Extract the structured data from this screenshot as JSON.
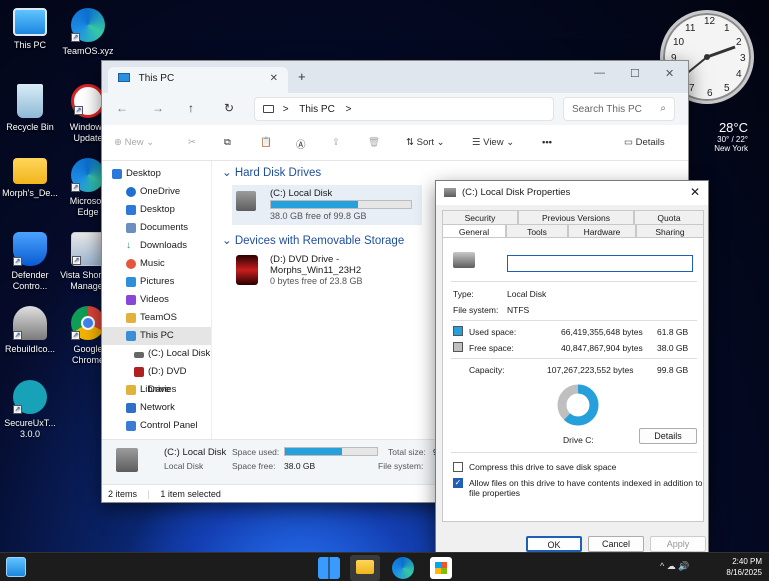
{
  "desktop": {
    "icons": [
      {
        "label": "This PC"
      },
      {
        "label": "TeamOS.xyz"
      },
      {
        "label": "Recycle Bin"
      },
      {
        "label": "Windows Update"
      },
      {
        "label": "Morph's_De..."
      },
      {
        "label": "Microsoft Edge"
      },
      {
        "label": "Defender Contro..."
      },
      {
        "label": "Vista Shortcut Manager"
      },
      {
        "label": "RebuildIco..."
      },
      {
        "label": "Google Chrome"
      },
      {
        "label": "SecureUxT... 3.0.0"
      }
    ],
    "clock_numbers": [
      "12",
      "1",
      "2",
      "3",
      "4",
      "5",
      "6",
      "7",
      "8",
      "9",
      "10",
      "11"
    ],
    "weather": {
      "temp": "28°C",
      "range": "30° / 22°",
      "city": "New York"
    }
  },
  "explorer": {
    "tab_title": "This PC",
    "tab_close": "✕",
    "new_tab": "+",
    "window_controls": {
      "minimize": "—",
      "maximize": "☐",
      "close": "✕"
    },
    "address": {
      "root_sep": ">",
      "location": "This PC",
      "trailing_sep": ">"
    },
    "search_placeholder": "Search This PC",
    "commands": {
      "new": "New",
      "sort": "Sort",
      "view": "View",
      "more": "•••",
      "details": "Details"
    },
    "nav": [
      {
        "label": "Desktop",
        "color": "#2b79d8"
      },
      {
        "label": "OneDrive",
        "color": "#1f6fd1"
      },
      {
        "label": "Desktop",
        "color": "#2b79d8"
      },
      {
        "label": "Documents",
        "color": "#6b8fbf"
      },
      {
        "label": "Downloads",
        "color": "#1c9b63"
      },
      {
        "label": "Music",
        "color": "#e4573d"
      },
      {
        "label": "Pictures",
        "color": "#2d8ed9"
      },
      {
        "label": "Videos",
        "color": "#8a46d6"
      },
      {
        "label": "TeamOS",
        "color": "#e2b33a"
      },
      {
        "label": "This PC",
        "color": "#3a8ed6"
      },
      {
        "label": "(C:) Local Disk",
        "color": "#666"
      },
      {
        "label": "(D:) DVD Drive",
        "color": "#b02020"
      },
      {
        "label": "Libraries",
        "color": "#e2b33a"
      },
      {
        "label": "Network",
        "color": "#2d6fc9"
      },
      {
        "label": "Control Panel",
        "color": "#3a7bd5"
      }
    ],
    "groups": {
      "hard_disk": "Hard Disk Drives",
      "removable": "Devices with Removable Storage"
    },
    "drives": {
      "c": {
        "name": "(C:) Local Disk",
        "free": "38.0 GB free of 99.8 GB",
        "used_fraction": 0.619
      },
      "d": {
        "name_line1": "(D:) DVD Drive -",
        "name_line2": "Morphs_Win11_23H2",
        "free": "0 bytes free of 23.8 GB"
      }
    },
    "details_pane": {
      "name": "(C:) Local Disk",
      "type": "Local Disk",
      "space_used_label": "Space used:",
      "space_free_label": "Space free:",
      "space_free": "38.0 GB",
      "total_size_label": "Total size:",
      "total_size": "9",
      "file_system_label": "File system:",
      "used_fraction": 0.619
    },
    "status": {
      "items": "2 items",
      "selected": "1 item selected"
    }
  },
  "properties": {
    "title": "(C:) Local Disk Properties",
    "tabs_top": [
      "Security",
      "Previous Versions",
      "Quota"
    ],
    "tabs_bottom": [
      "General",
      "Tools",
      "Hardware",
      "Sharing"
    ],
    "label_value": "",
    "type_label": "Type:",
    "type_value": "Local Disk",
    "fs_label": "File system:",
    "fs_value": "NTFS",
    "used_label": "Used space:",
    "used_bytes": "66,419,355,648 bytes",
    "used_gb": "61.8 GB",
    "free_label": "Free space:",
    "free_bytes": "40,847,867,904 bytes",
    "free_gb": "38.0 GB",
    "capacity_label": "Capacity:",
    "capacity_bytes": "107,267,223,552 bytes",
    "capacity_gb": "99.8 GB",
    "drive_label": "Drive C:",
    "details_button": "Details",
    "compress_label": "Compress this drive to save disk space",
    "compress_checked": false,
    "index_label_1": "Allow files on this drive to have contents indexed in addition to",
    "index_label_2": "file properties",
    "index_checked": true,
    "buttons": {
      "ok": "OK",
      "cancel": "Cancel",
      "apply": "Apply"
    },
    "used_color": "#26a0da",
    "free_color": "#bfbfbf",
    "used_fraction": 0.619
  },
  "taskbar": {
    "time": "2:40 PM",
    "date": "8/16/2025",
    "tray": "^ ☁ 🔊"
  }
}
